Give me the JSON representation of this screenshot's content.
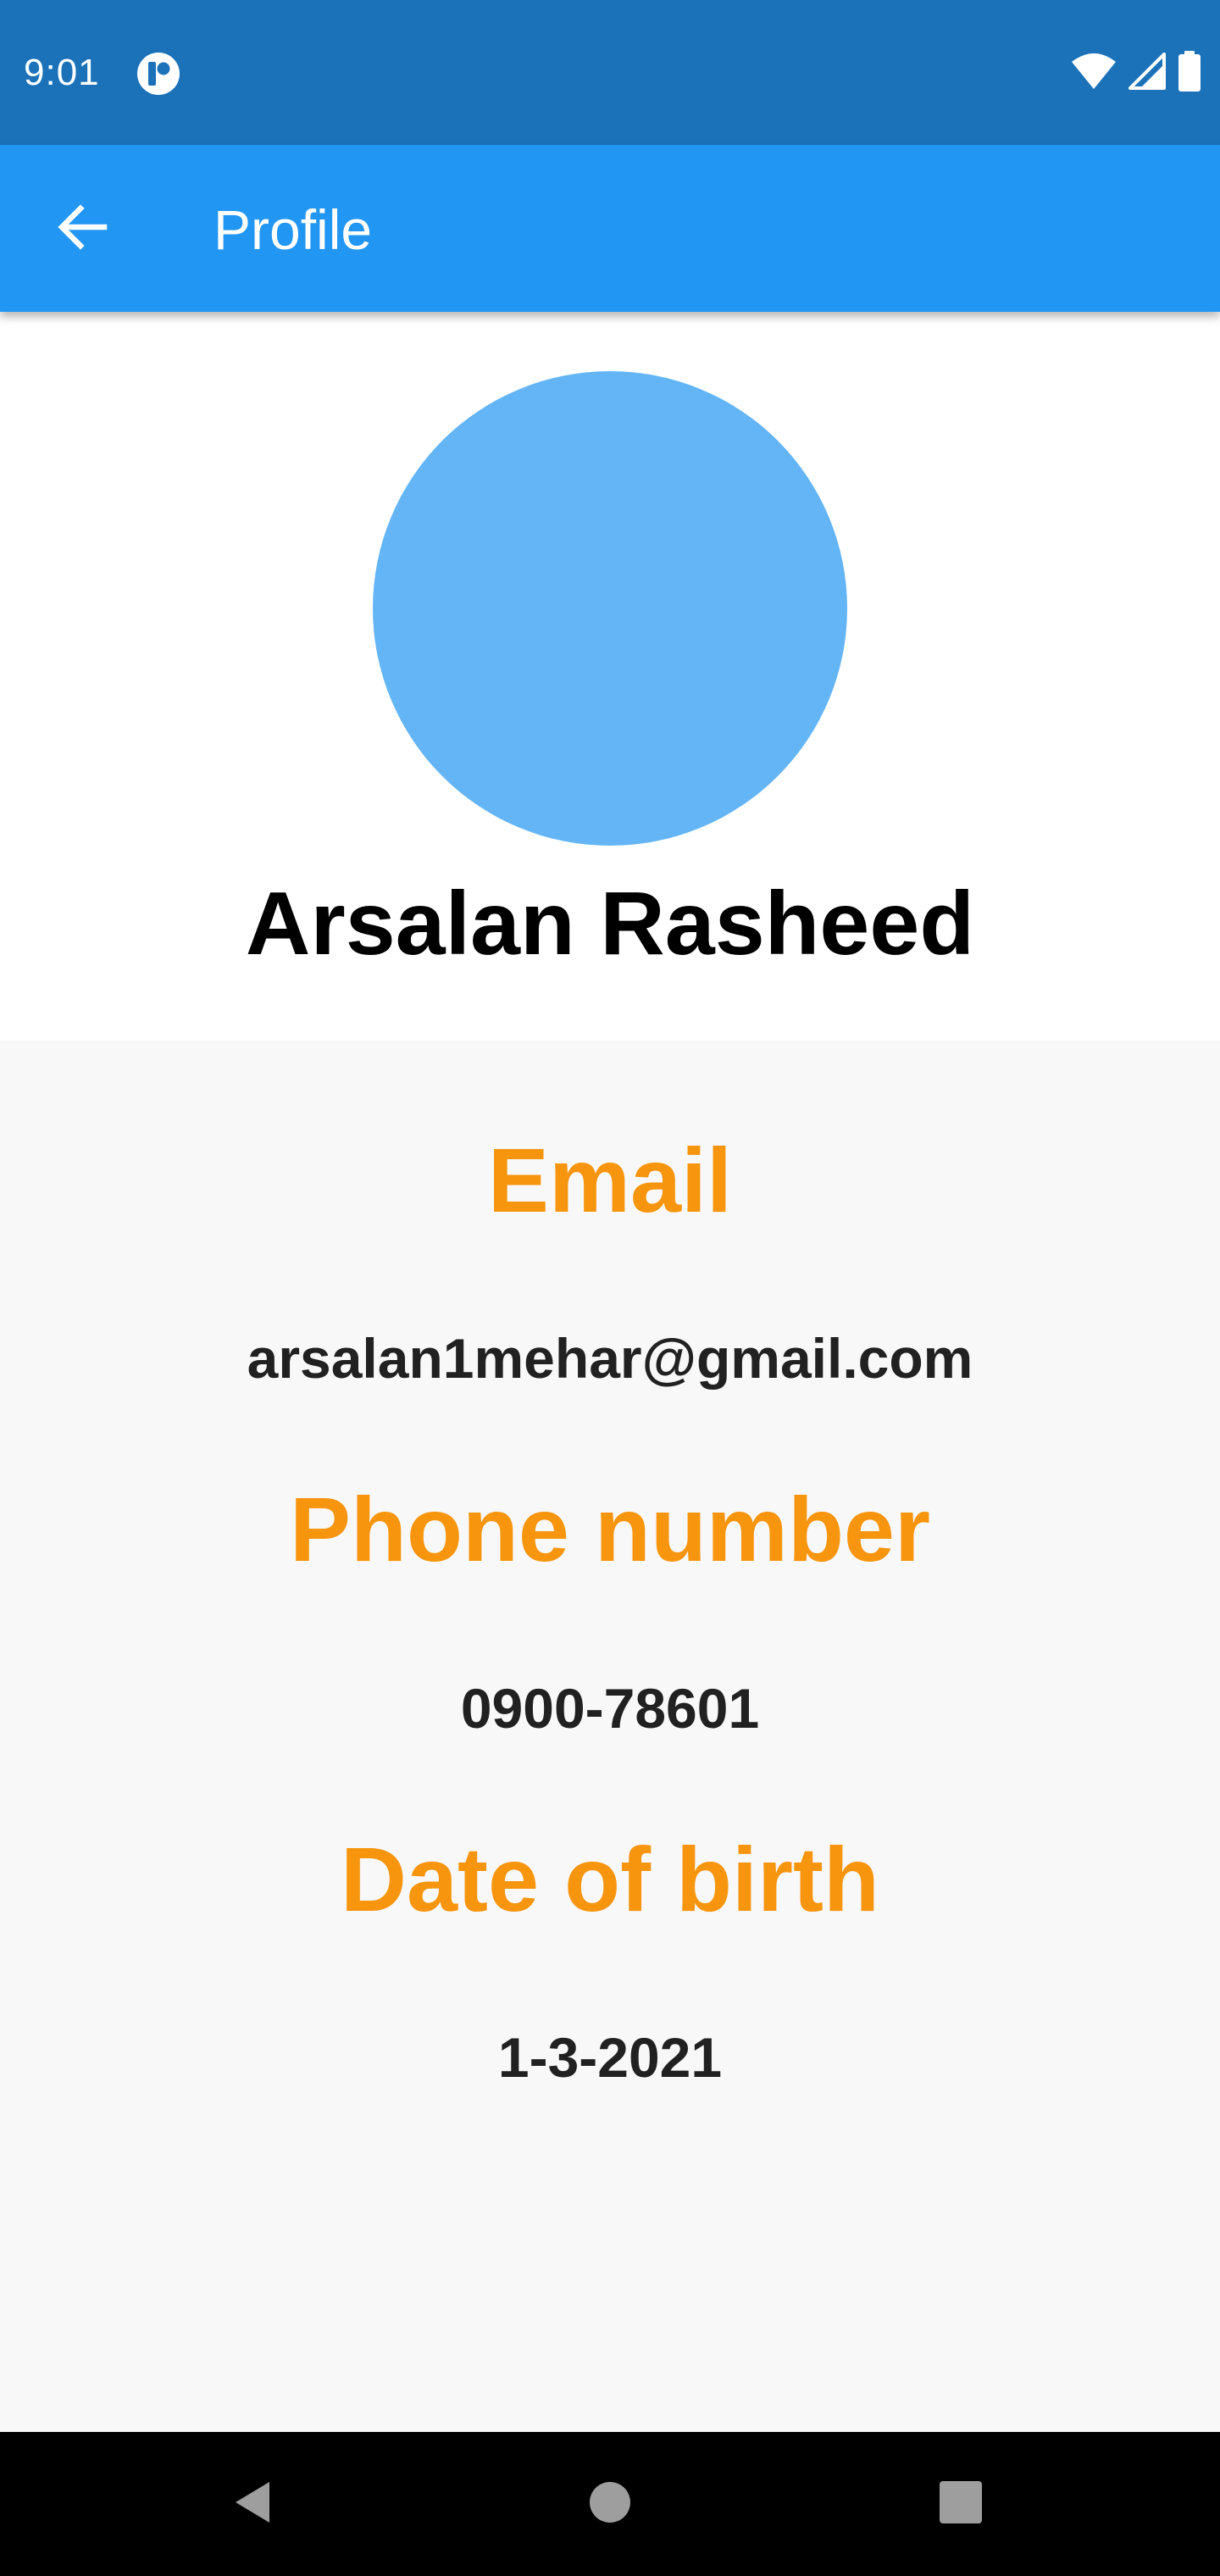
{
  "status_bar": {
    "time": "9:01",
    "icons": [
      "app-notification-icon",
      "wifi-icon",
      "cellular-signal-icon",
      "battery-icon"
    ],
    "background": "#1b72b9"
  },
  "app_bar": {
    "title": "Profile",
    "back_icon": "arrow-back-icon",
    "background": "#2196f3"
  },
  "profile": {
    "name": "Arsalan Rasheed",
    "avatar_color": "#64b5f6"
  },
  "details": {
    "email_label": "Email",
    "email_value": "arsalan1mehar@gmail.com",
    "phone_label": "Phone number",
    "phone_value": "0900-78601",
    "dob_label": "Date of birth",
    "dob_value": "1-3-2021",
    "label_color": "#f7950f"
  },
  "nav_bar": {
    "icons": [
      "nav-back-icon",
      "nav-home-icon",
      "nav-recents-icon"
    ]
  }
}
